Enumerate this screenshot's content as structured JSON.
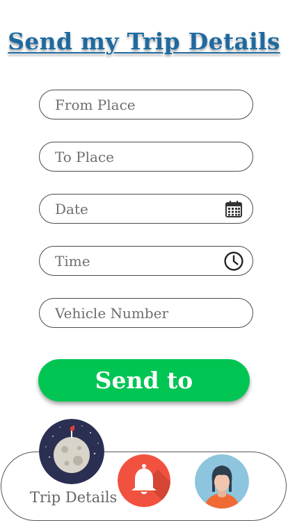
{
  "header": {
    "title": "Send my Trip Details"
  },
  "form": {
    "from_place_placeholder": "From Place",
    "to_place_placeholder": "To Place",
    "date_placeholder": "Date",
    "time_placeholder": "Time",
    "vehicle_number_placeholder": "Vehicle Number"
  },
  "actions": {
    "send_label": "Send to"
  },
  "bottom_nav": {
    "items": [
      {
        "label": "Trip Details",
        "icon": "moon-rocket-icon"
      },
      {
        "icon": "bell-icon"
      },
      {
        "icon": "user-avatar-icon"
      }
    ]
  },
  "colors": {
    "title": "#1e6aa0",
    "send_button": "#00c553",
    "bell": "#f0523f",
    "avatar_bg": "#8cc5dd"
  }
}
